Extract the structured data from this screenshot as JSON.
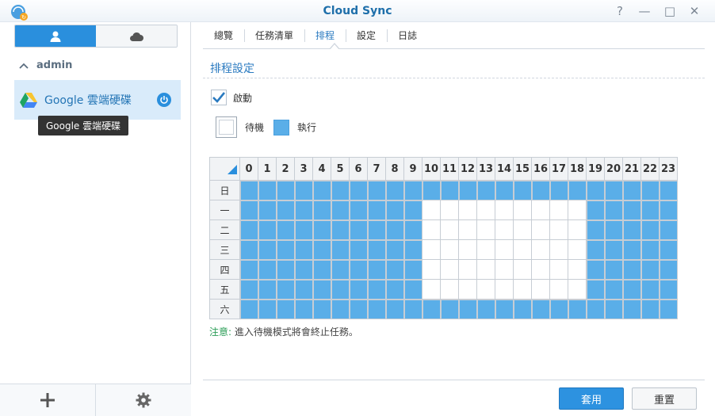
{
  "window": {
    "title": "Cloud Sync",
    "controls": [
      "?",
      "—",
      "□",
      "✕"
    ]
  },
  "sidebar": {
    "group_label": "admin",
    "task": {
      "name": "Google 雲端硬碟",
      "tooltip": "Google 雲端硬碟"
    }
  },
  "tabs": [
    {
      "label": "總覽",
      "active": false
    },
    {
      "label": "任務清單",
      "active": false
    },
    {
      "label": "排程",
      "active": true
    },
    {
      "label": "設定",
      "active": false
    },
    {
      "label": "日誌",
      "active": false
    }
  ],
  "schedule": {
    "section_title": "排程設定",
    "enable_label": "啟動",
    "enabled": true,
    "legend_idle": "待機",
    "legend_run": "執行",
    "hours": [
      "0",
      "1",
      "2",
      "3",
      "4",
      "5",
      "6",
      "7",
      "8",
      "9",
      "10",
      "11",
      "12",
      "13",
      "14",
      "15",
      "16",
      "17",
      "18",
      "19",
      "20",
      "21",
      "22",
      "23"
    ],
    "days": [
      {
        "label": "日",
        "run": [
          1,
          1,
          1,
          1,
          1,
          1,
          1,
          1,
          1,
          1,
          1,
          1,
          1,
          1,
          1,
          1,
          1,
          1,
          1,
          1,
          1,
          1,
          1,
          1
        ]
      },
      {
        "label": "一",
        "run": [
          1,
          1,
          1,
          1,
          1,
          1,
          1,
          1,
          1,
          1,
          0,
          0,
          0,
          0,
          0,
          0,
          0,
          0,
          0,
          1,
          1,
          1,
          1,
          1
        ]
      },
      {
        "label": "二",
        "run": [
          1,
          1,
          1,
          1,
          1,
          1,
          1,
          1,
          1,
          1,
          0,
          0,
          0,
          0,
          0,
          0,
          0,
          0,
          0,
          1,
          1,
          1,
          1,
          1
        ]
      },
      {
        "label": "三",
        "run": [
          1,
          1,
          1,
          1,
          1,
          1,
          1,
          1,
          1,
          1,
          0,
          0,
          0,
          0,
          0,
          0,
          0,
          0,
          0,
          1,
          1,
          1,
          1,
          1
        ]
      },
      {
        "label": "四",
        "run": [
          1,
          1,
          1,
          1,
          1,
          1,
          1,
          1,
          1,
          1,
          0,
          0,
          0,
          0,
          0,
          0,
          0,
          0,
          0,
          1,
          1,
          1,
          1,
          1
        ]
      },
      {
        "label": "五",
        "run": [
          1,
          1,
          1,
          1,
          1,
          1,
          1,
          1,
          1,
          1,
          0,
          0,
          0,
          0,
          0,
          0,
          0,
          0,
          0,
          1,
          1,
          1,
          1,
          1
        ]
      },
      {
        "label": "六",
        "run": [
          1,
          1,
          1,
          1,
          1,
          1,
          1,
          1,
          1,
          1,
          1,
          1,
          1,
          1,
          1,
          1,
          1,
          1,
          1,
          1,
          1,
          1,
          1,
          1
        ]
      }
    ],
    "note_label": "注意:",
    "note_text": "進入待機模式將會終止任務。"
  },
  "buttons": {
    "apply": "套用",
    "reset": "重置"
  },
  "colors": {
    "accent": "#2a8fdd",
    "run_cell": "#5aaee8",
    "note_label": "#2a9d56"
  },
  "icons": [
    "app-cloud-sync-icon",
    "user-icon",
    "cloud-icon",
    "chevron-up-icon",
    "google-drive-icon",
    "power-icon",
    "plus-icon",
    "gear-icon",
    "checkmark-icon"
  ]
}
